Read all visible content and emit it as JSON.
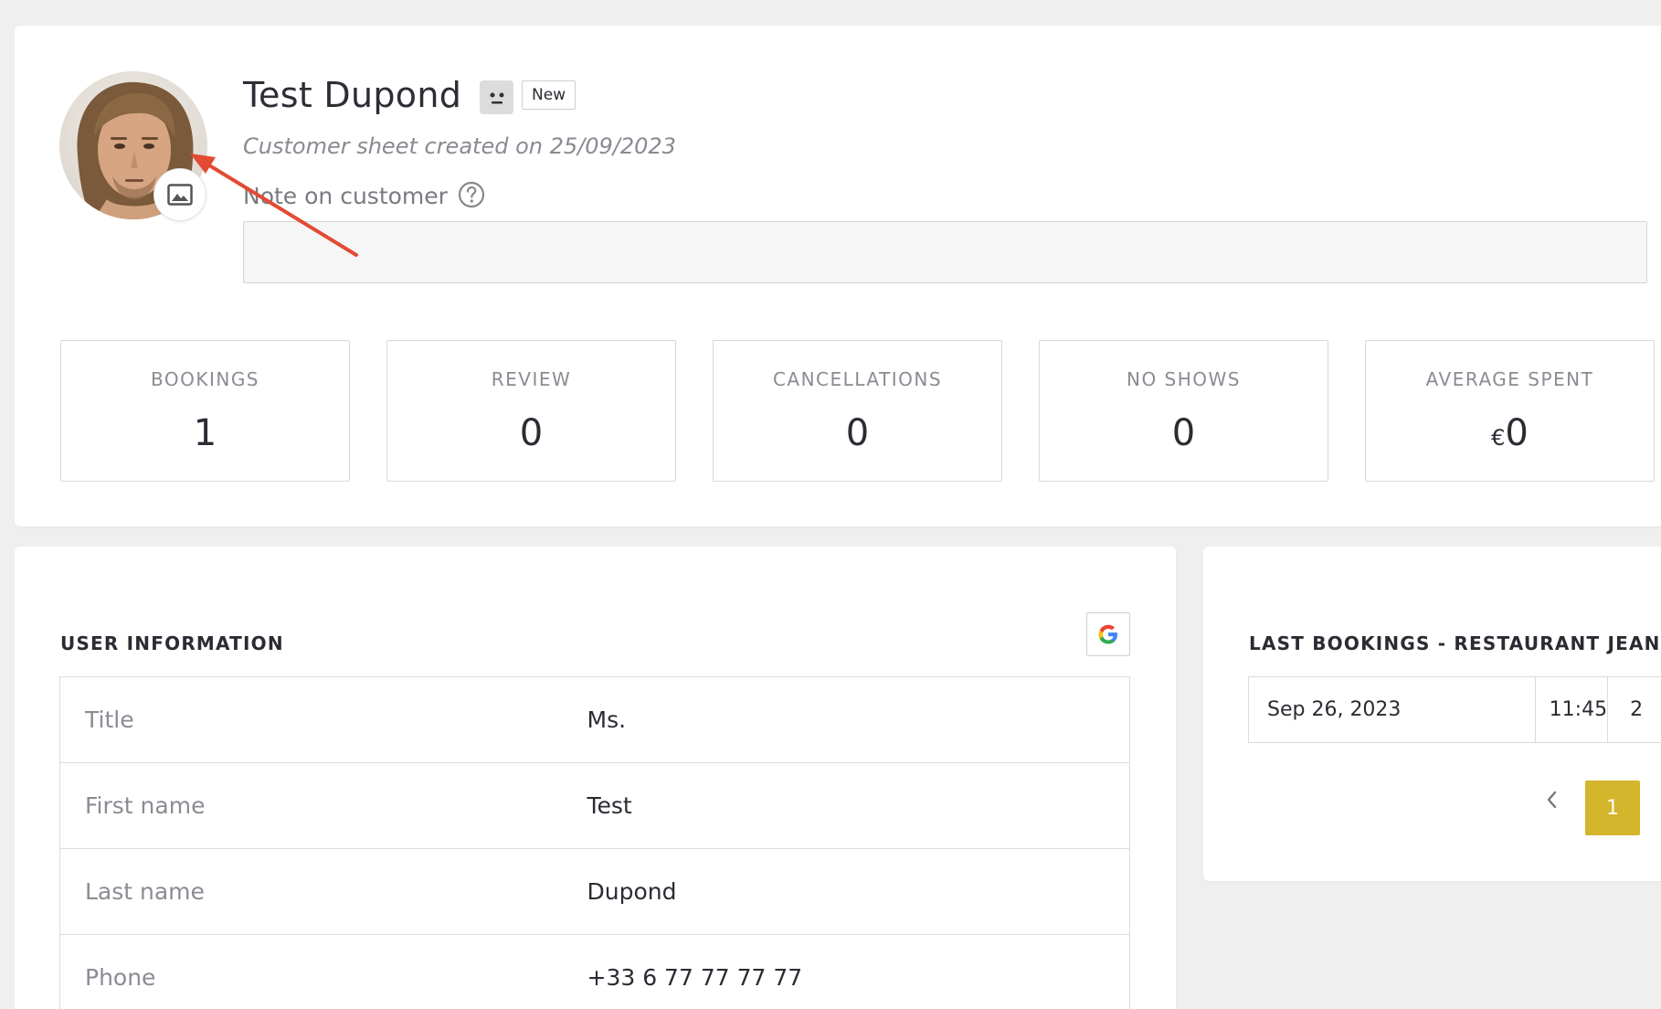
{
  "customer": {
    "name": "Test Dupond",
    "badge": "New",
    "created": "Customer sheet created on 25/09/2023",
    "note_label": "Note on customer",
    "note_value": ""
  },
  "stats": [
    {
      "label": "BOOKINGS",
      "value": "1"
    },
    {
      "label": "REVIEW",
      "value": "0"
    },
    {
      "label": "CANCELLATIONS",
      "value": "0"
    },
    {
      "label": "NO SHOWS",
      "value": "0"
    },
    {
      "label": "AVERAGE SPENT",
      "currency": "€",
      "value": "0"
    }
  ],
  "user_info": {
    "title": "USER INFORMATION",
    "rows": [
      {
        "key": "Title",
        "value": "Ms."
      },
      {
        "key": "First name",
        "value": "Test"
      },
      {
        "key": "Last name",
        "value": "Dupond"
      },
      {
        "key": "Phone",
        "value": "+33 6 77 77 77 77"
      }
    ]
  },
  "last_bookings": {
    "title": "LAST BOOKINGS - RESTAURANT JEANNE",
    "rows": [
      {
        "date": "Sep 26, 2023",
        "time": "11:45",
        "guests": "2"
      }
    ],
    "current_page": "1"
  },
  "colors": {
    "accent": "#d4b52c",
    "annotation_arrow": "#e34a33"
  },
  "icons": {
    "avatar_change": "image-icon",
    "help": "question-circle-icon",
    "google": "google-g-icon",
    "status": "neutral-face-icon"
  }
}
